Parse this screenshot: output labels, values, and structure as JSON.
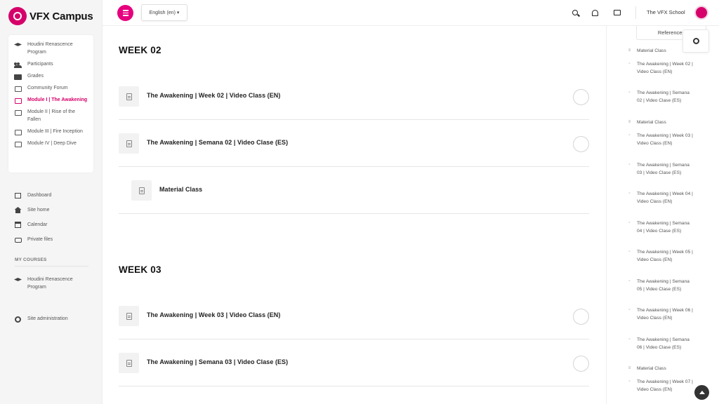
{
  "brand": {
    "name": "VFX Campus"
  },
  "course_nav": [
    {
      "label": "Houdini Renascence Program",
      "icon": "graduation-cap-icon"
    },
    {
      "label": "Participants",
      "icon": "users-icon"
    },
    {
      "label": "Grades",
      "icon": "book-icon"
    },
    {
      "label": "Community Forum",
      "icon": "folder-icon"
    },
    {
      "label": "Module I | The Awakening",
      "icon": "folder-icon",
      "active": true
    },
    {
      "label": "Module II | Rise of the Fallen",
      "icon": "folder-icon"
    },
    {
      "label": "Module III | Fire Inception",
      "icon": "folder-icon"
    },
    {
      "label": "Module IV | Deep Dive",
      "icon": "folder-icon"
    }
  ],
  "site_nav": [
    {
      "label": "Dashboard",
      "icon": "dashboard-icon"
    },
    {
      "label": "Site home",
      "icon": "home-icon"
    },
    {
      "label": "Calendar",
      "icon": "calendar-icon"
    },
    {
      "label": "Private files",
      "icon": "drive-icon"
    }
  ],
  "my_courses": {
    "heading": "MY COURSES",
    "items": [
      {
        "label": "Houdini Renascence Program",
        "icon": "graduation-cap-icon"
      }
    ]
  },
  "site_admin": {
    "label": "Site administration",
    "icon": "gear-icon"
  },
  "topbar": {
    "language": "English (en)",
    "language_caret": "▾",
    "user_name": "The VFX School"
  },
  "weeks": [
    {
      "title": "WEEK 02",
      "activities": [
        {
          "title": "The Awakening | Week 02 | Video Class (EN)",
          "completion": false
        },
        {
          "title": "The Awakening | Semana 02 | Video Clase (ES)",
          "completion": false
        },
        {
          "title": "Material Class",
          "indented": true
        }
      ]
    },
    {
      "title": "WEEK 03",
      "activities": [
        {
          "title": "The Awakening | Week 03 | Video Class (EN)",
          "completion": false
        },
        {
          "title": "The Awakening | Semana 03 | Video Clase (ES)",
          "completion": false
        }
      ]
    }
  ],
  "drawer": {
    "tab_label": "References",
    "items": [
      "Material Class",
      "The Awakening | Week 02 | Video Class (EN)",
      "The Awakening | Semana 02 | Video Clase (ES)",
      "Material Class",
      "The Awakening | Week 03 | Video Class (EN)",
      "The Awakening | Semana 03 | Video Clase (ES)",
      "The Awakening | Week 04 | Video Class (EN)",
      "The Awakening | Semana 04 | Video Clase (ES)",
      "The Awakening | Week 05 | Video Class (EN)",
      "The Awakening | Semana 05 | Video Clase (ES)",
      "The Awakening | Week 06 | Video Class (EN)",
      "The Awakening | Semana 06 | Video Clase (ES)",
      "Material Class",
      "The Awakening | Week 07 | Video Class (EN)"
    ]
  },
  "colors": {
    "accent": "#e6007e",
    "active_text": "#d6006a"
  }
}
